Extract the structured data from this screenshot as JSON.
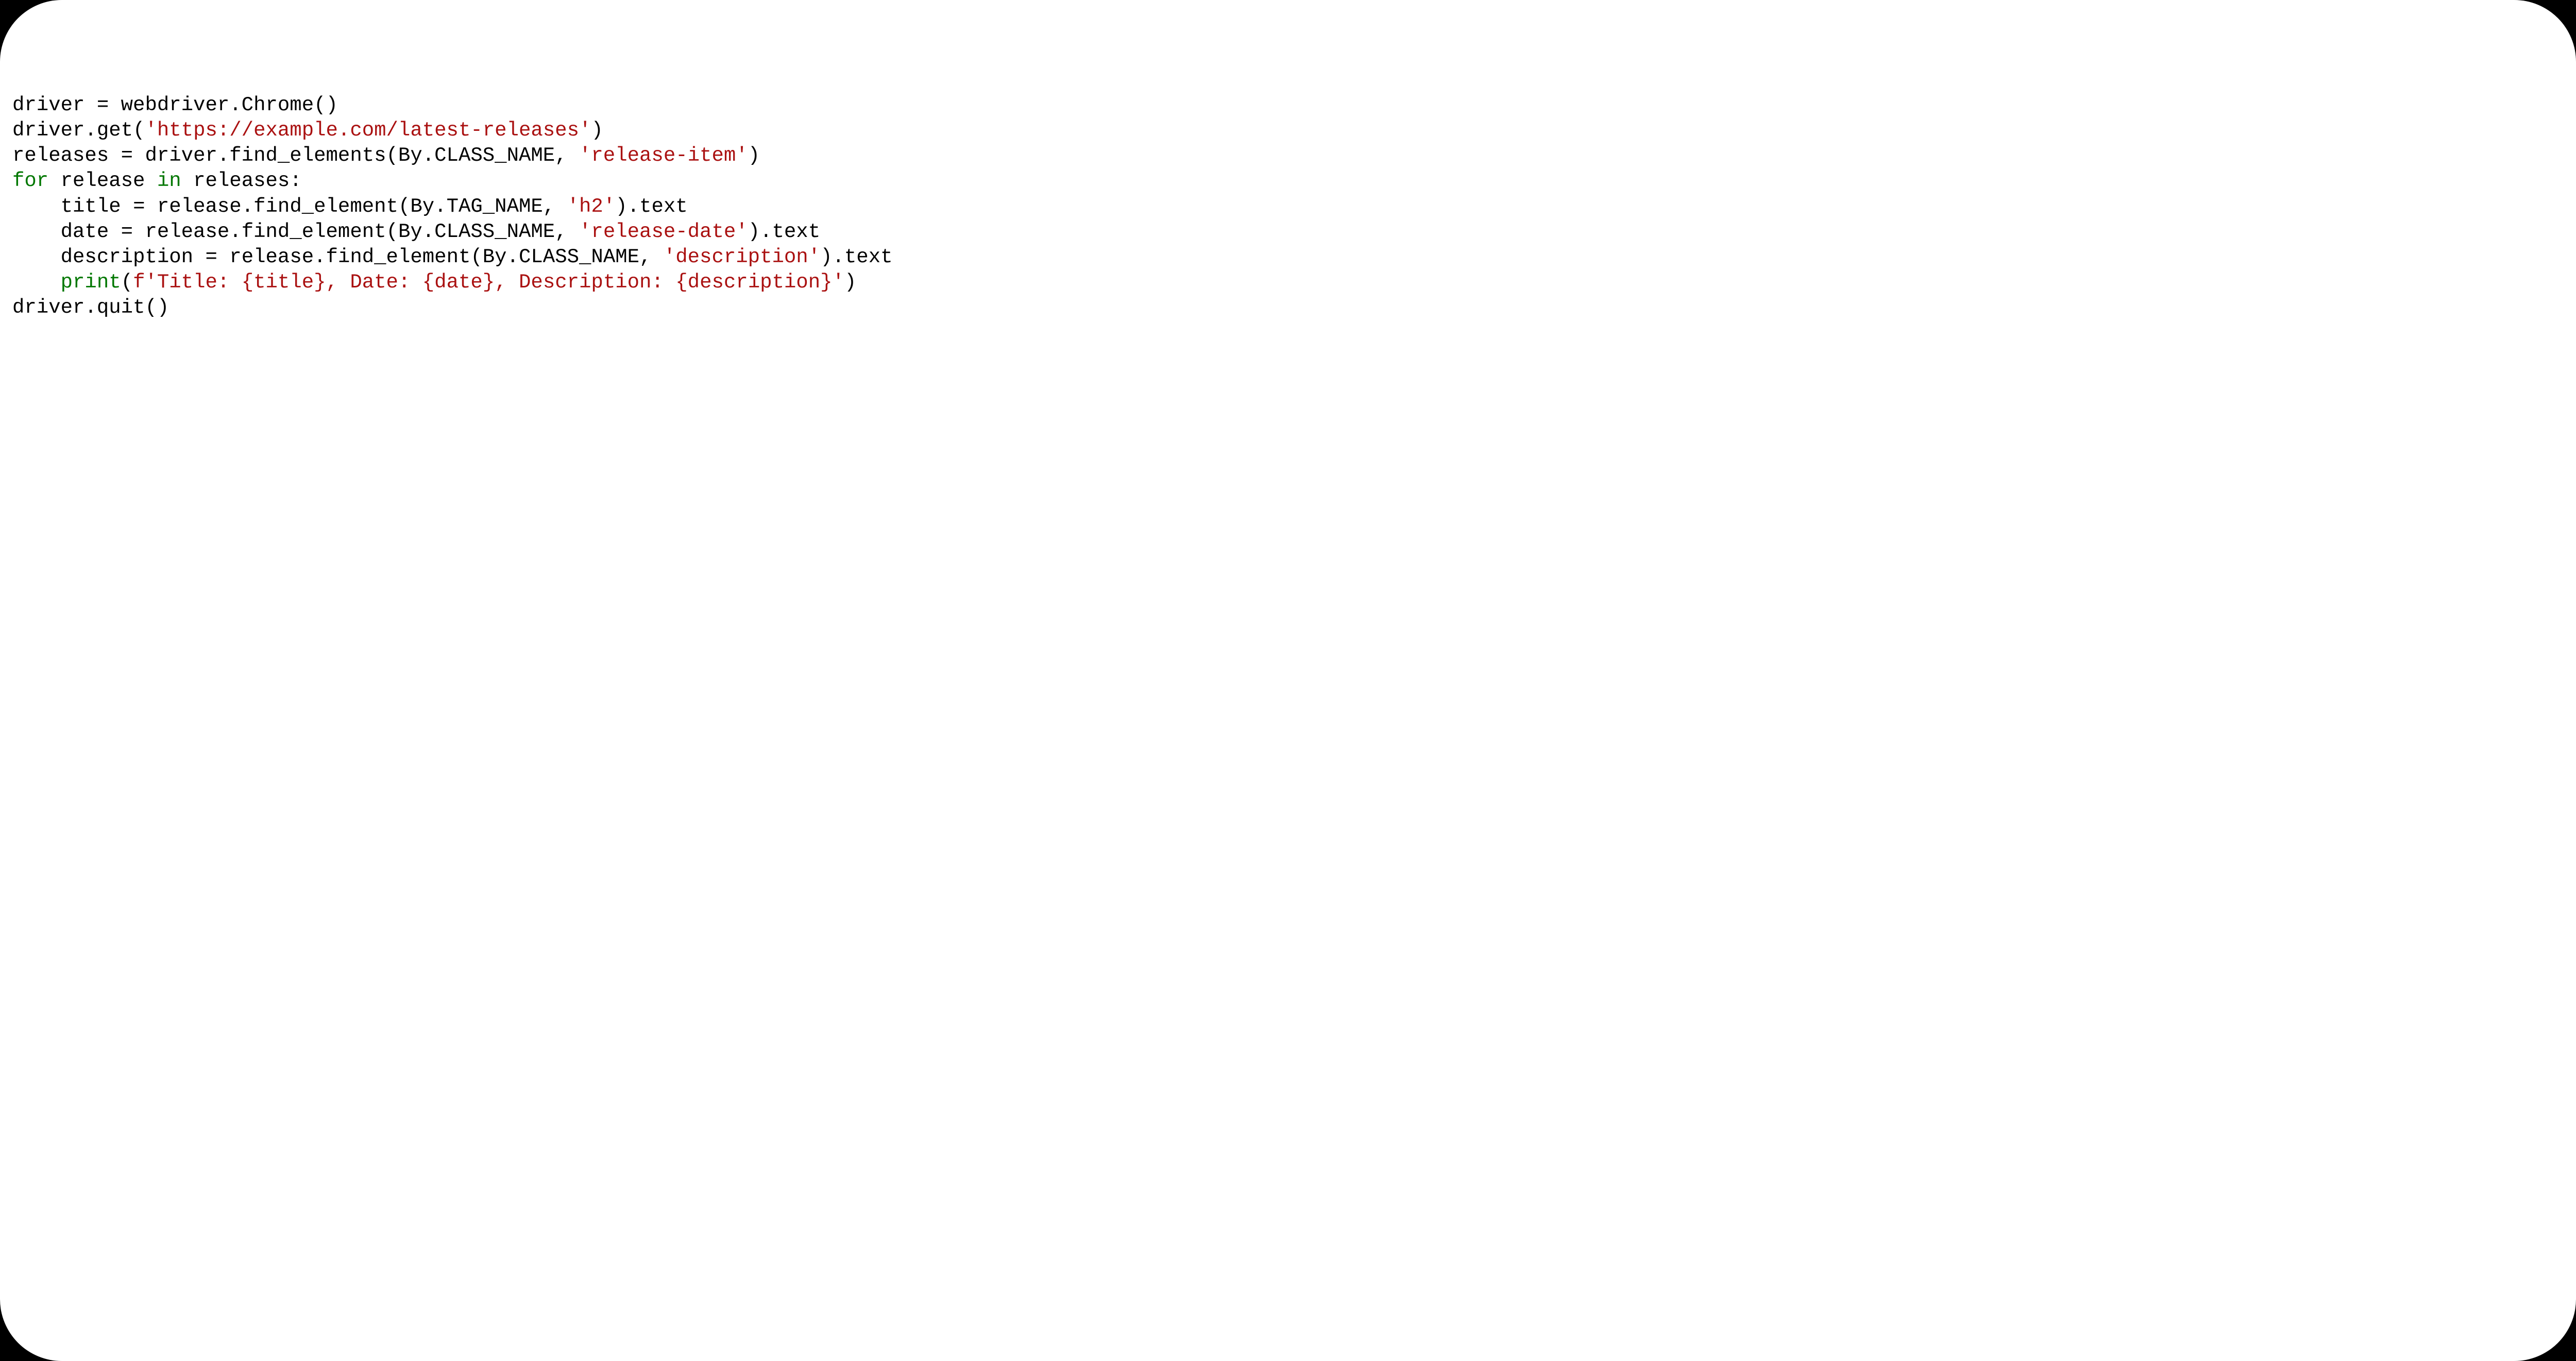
{
  "code": {
    "lines": [
      {
        "indent": 0,
        "segments": [
          {
            "cls": "tok-op",
            "t": "driver "
          },
          {
            "cls": "tok-op",
            "t": "="
          },
          {
            "cls": "tok-op",
            "t": " webdriver.Chrome()"
          }
        ]
      },
      {
        "indent": 0,
        "segments": [
          {
            "cls": "tok-op",
            "t": "driver.get("
          },
          {
            "cls": "tok-str",
            "t": "'https://example.com/latest-releases'"
          },
          {
            "cls": "tok-op",
            "t": ")"
          }
        ]
      },
      {
        "indent": 0,
        "segments": [
          {
            "cls": "tok-op",
            "t": "releases "
          },
          {
            "cls": "tok-op",
            "t": "="
          },
          {
            "cls": "tok-op",
            "t": " driver.find_elements(By.CLASS_NAME, "
          },
          {
            "cls": "tok-str",
            "t": "'release-item'"
          },
          {
            "cls": "tok-op",
            "t": ")"
          }
        ]
      },
      {
        "indent": 0,
        "segments": [
          {
            "cls": "tok-kw",
            "t": "for"
          },
          {
            "cls": "tok-op",
            "t": " release "
          },
          {
            "cls": "tok-kw",
            "t": "in"
          },
          {
            "cls": "tok-op",
            "t": " releases:"
          }
        ]
      },
      {
        "indent": 1,
        "segments": [
          {
            "cls": "tok-op",
            "t": "title "
          },
          {
            "cls": "tok-op",
            "t": "="
          },
          {
            "cls": "tok-op",
            "t": " release.find_element(By.TAG_NAME, "
          },
          {
            "cls": "tok-str",
            "t": "'h2'"
          },
          {
            "cls": "tok-op",
            "t": ").text"
          }
        ]
      },
      {
        "indent": 1,
        "segments": [
          {
            "cls": "tok-op",
            "t": "date "
          },
          {
            "cls": "tok-op",
            "t": "="
          },
          {
            "cls": "tok-op",
            "t": " release.find_element(By.CLASS_NAME, "
          },
          {
            "cls": "tok-str",
            "t": "'release-date'"
          },
          {
            "cls": "tok-op",
            "t": ").text"
          }
        ]
      },
      {
        "indent": 1,
        "segments": [
          {
            "cls": "tok-op",
            "t": "description "
          },
          {
            "cls": "tok-op",
            "t": "="
          },
          {
            "cls": "tok-op",
            "t": " release.find_element(By.CLASS_NAME, "
          },
          {
            "cls": "tok-str",
            "t": "'description'"
          },
          {
            "cls": "tok-op",
            "t": ").text"
          }
        ]
      },
      {
        "indent": 1,
        "segments": [
          {
            "cls": "tok-bi",
            "t": "print"
          },
          {
            "cls": "tok-op",
            "t": "("
          },
          {
            "cls": "tok-strp",
            "t": "f'Title: "
          },
          {
            "cls": "tok-str",
            "t": "{title}"
          },
          {
            "cls": "tok-strp",
            "t": ", Date: "
          },
          {
            "cls": "tok-str",
            "t": "{date}"
          },
          {
            "cls": "tok-strp",
            "t": ", Description: "
          },
          {
            "cls": "tok-str",
            "t": "{description}"
          },
          {
            "cls": "tok-strp",
            "t": "'"
          },
          {
            "cls": "tok-op",
            "t": ")"
          }
        ]
      },
      {
        "indent": 0,
        "segments": [
          {
            "cls": "tok-op",
            "t": "driver.quit()"
          }
        ]
      }
    ],
    "indent_unit": "    "
  }
}
